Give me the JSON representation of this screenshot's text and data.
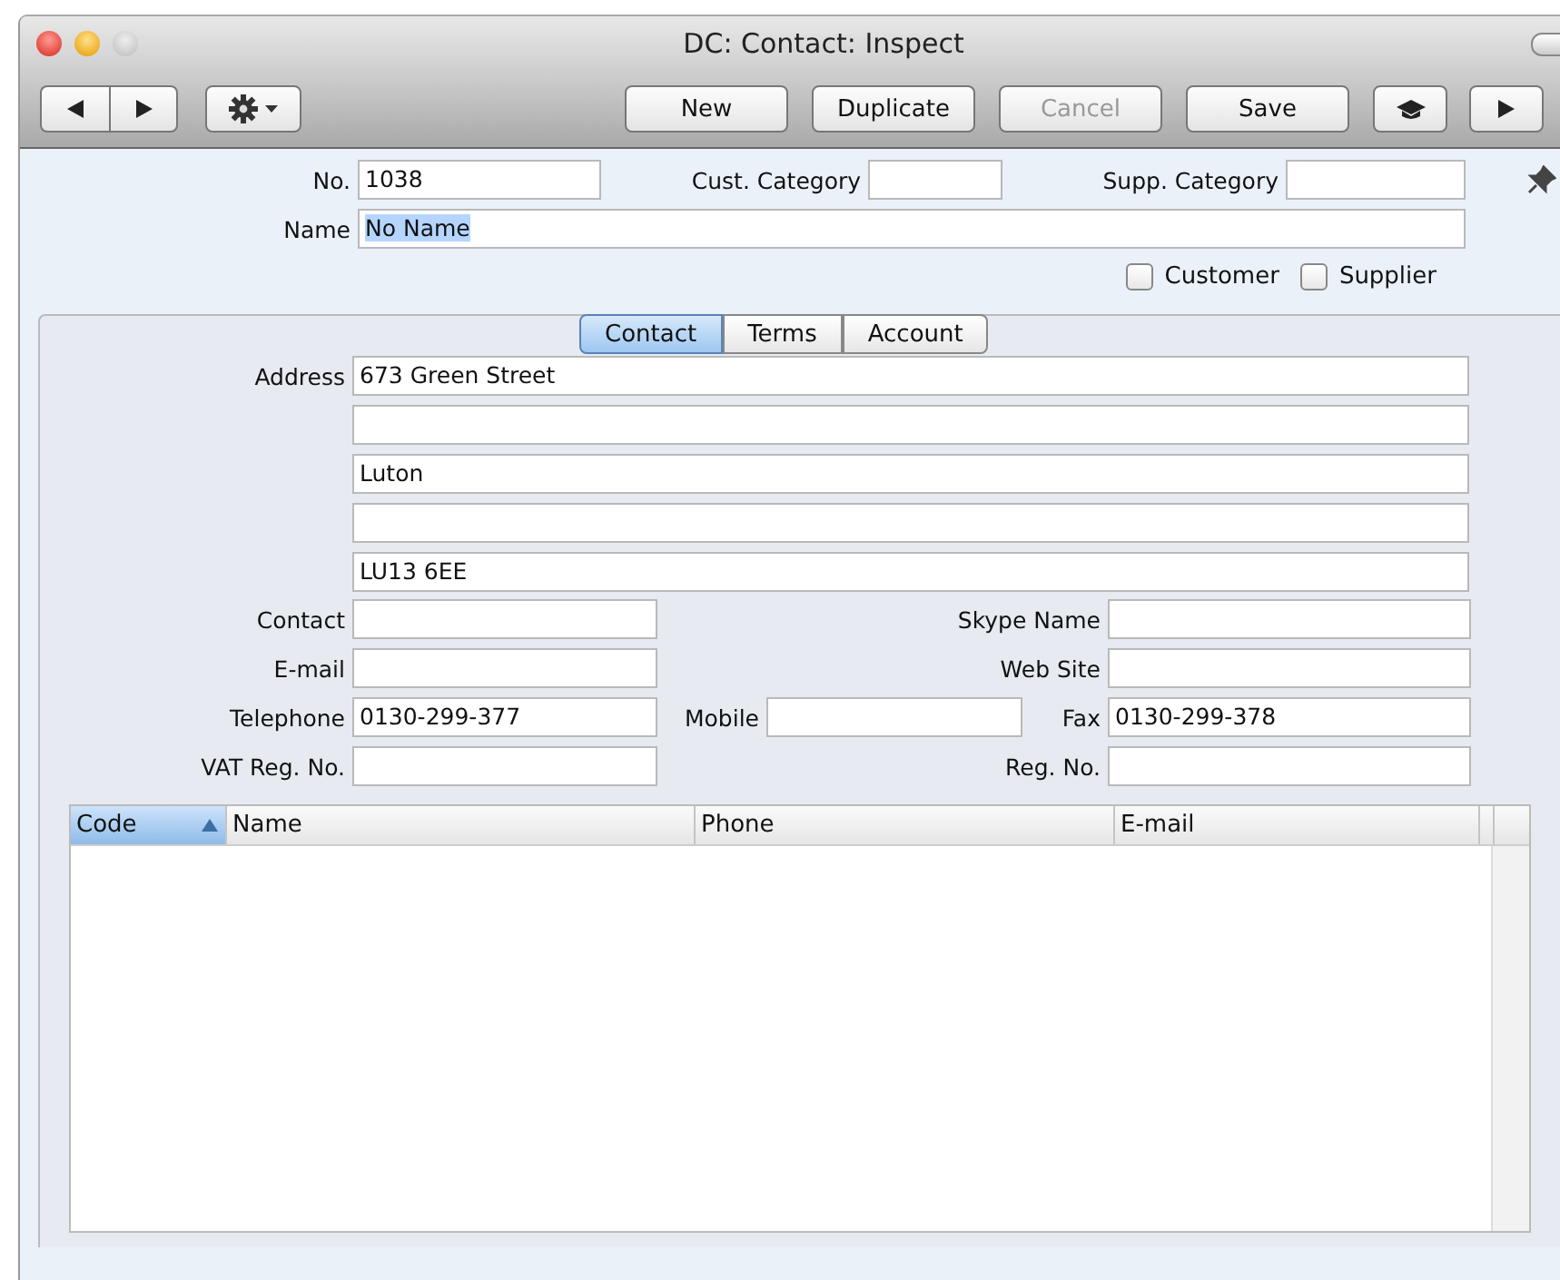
{
  "window": {
    "title": "DC: Contact: Inspect"
  },
  "toolbar": {
    "buttons": [
      {
        "label": "New",
        "disabled": false
      },
      {
        "label": "Duplicate",
        "disabled": false
      },
      {
        "label": "Cancel",
        "disabled": true
      },
      {
        "label": "Save",
        "disabled": false
      }
    ]
  },
  "header": {
    "no": {
      "label": "No.",
      "value": "1038"
    },
    "cust_category": {
      "label": "Cust. Category"
    },
    "supp_category": {
      "label": "Supp. Category"
    },
    "name": {
      "label": "Name",
      "value": "No Name",
      "highlighted": true
    }
  },
  "checkboxes": [
    {
      "label": "Customer",
      "checked": false
    },
    {
      "label": "Supplier",
      "checked": false
    }
  ],
  "tabs": [
    {
      "label": "Contact",
      "selected": true
    },
    {
      "label": "Terms",
      "selected": false
    },
    {
      "label": "Account",
      "selected": false
    }
  ],
  "address": {
    "label": "Address",
    "lines": [
      {
        "kind": "text",
        "value": "673 Green Street"
      },
      {
        "kind": "blank"
      },
      {
        "kind": "text",
        "value": "Luton"
      },
      {
        "kind": "blank"
      },
      {
        "kind": "text",
        "value": "LU13 6EE"
      }
    ]
  },
  "contact_rows": [
    {
      "left": {
        "label": "Contact"
      },
      "right": {
        "label": "Skype Name"
      }
    },
    {
      "left": {
        "label": "E-mail"
      },
      "right": {
        "label": "Web Site"
      }
    },
    {
      "left": {
        "label": "Telephone",
        "value": "0130-299-377"
      },
      "middle": {
        "label": "Mobile"
      },
      "right": {
        "label": "Fax",
        "value": "0130-299-378"
      }
    },
    {
      "left": {
        "label": "VAT Reg. No."
      },
      "right": {
        "label": "Reg. No."
      }
    }
  ],
  "table": {
    "columns": [
      {
        "label": "Code",
        "sorted": true
      },
      {
        "label": "Name",
        "sorted": false
      },
      {
        "label": "Phone",
        "sorted": false
      },
      {
        "label": "E-mail",
        "sorted": false
      }
    ]
  }
}
